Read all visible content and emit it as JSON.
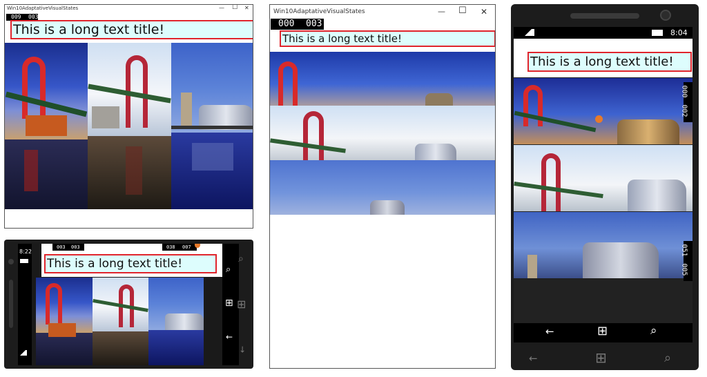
{
  "panel1": {
    "window_title": "Win10AdaptativeVisualStates",
    "counters": [
      "009",
      "003"
    ],
    "title": "This is a long text title!"
  },
  "panel2": {
    "window_title": "Win10AdaptativeVisualStates",
    "counters": [
      "000",
      "003"
    ],
    "title": "This is a long text title!"
  },
  "panel3": {
    "status_time": "8:04",
    "title": "This is a long text title!",
    "side_counters": [
      "000",
      "002",
      "051",
      "005"
    ]
  },
  "panel4": {
    "status_time": "8:22",
    "counters_left": [
      "003",
      "003"
    ],
    "counters_right": [
      "038",
      "007"
    ],
    "title": "This is a long text title!"
  },
  "icons": {
    "minimize": "—",
    "maximize": "☐",
    "close": "✕",
    "back": "←",
    "search": "⌕",
    "windows": "⊞"
  }
}
